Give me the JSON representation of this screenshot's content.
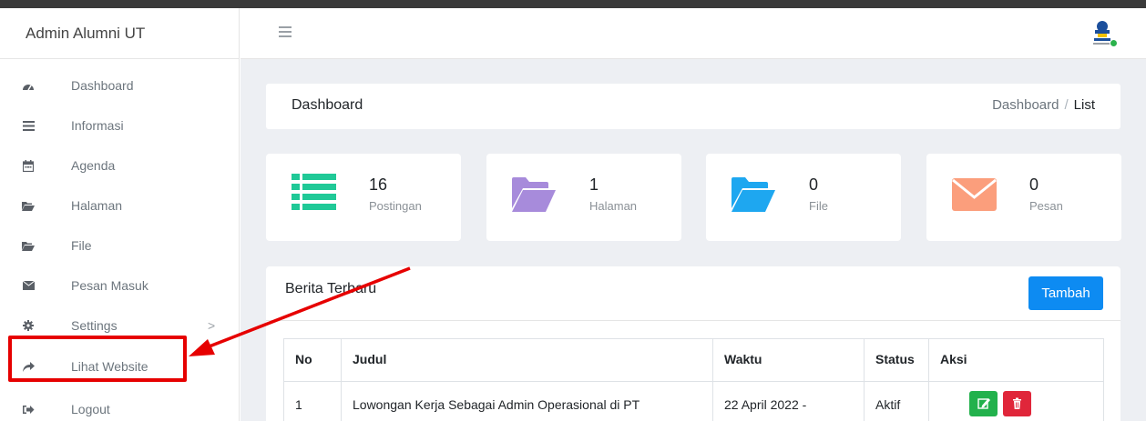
{
  "app": {
    "brand": "Admin Alumni UT"
  },
  "sidebar": {
    "items": [
      {
        "label": "Dashboard",
        "icon": "dashboard-icon"
      },
      {
        "label": "Informasi",
        "icon": "list-icon"
      },
      {
        "label": "Agenda",
        "icon": "calendar-icon"
      },
      {
        "label": "Halaman",
        "icon": "folder-icon"
      },
      {
        "label": "File",
        "icon": "folder-icon"
      },
      {
        "label": "Pesan Masuk",
        "icon": "envelope-icon"
      },
      {
        "label": "Settings",
        "icon": "gear-icon",
        "arrow": ">"
      },
      {
        "label": "Lihat Website",
        "icon": "share-icon"
      },
      {
        "label": "Logout",
        "icon": "sign-out-icon"
      }
    ]
  },
  "header": {
    "title": "Dashboard",
    "breadcrumb": {
      "parent": "Dashboard",
      "separator": "/",
      "current": "List"
    }
  },
  "stats": [
    {
      "value": "16",
      "label": "Postingan",
      "color": "#20c997"
    },
    {
      "value": "1",
      "label": "Halaman",
      "color": "#a78bdb"
    },
    {
      "value": "0",
      "label": "File",
      "color": "#1ea7f0"
    },
    {
      "value": "0",
      "label": "Pesan",
      "color": "#fb9e7c"
    }
  ],
  "berita": {
    "title": "Berita Terbaru",
    "add_label": "Tambah",
    "columns": [
      "No",
      "Judul",
      "Waktu",
      "Status",
      "Aksi"
    ],
    "rows": [
      {
        "no": "1",
        "judul": "Lowongan Kerja Sebagai Admin Operasional di PT",
        "waktu": "22 April 2022 -",
        "status": "Aktif"
      }
    ]
  },
  "colors": {
    "accent": "#0d8bf2",
    "annotation": "#e60000"
  }
}
